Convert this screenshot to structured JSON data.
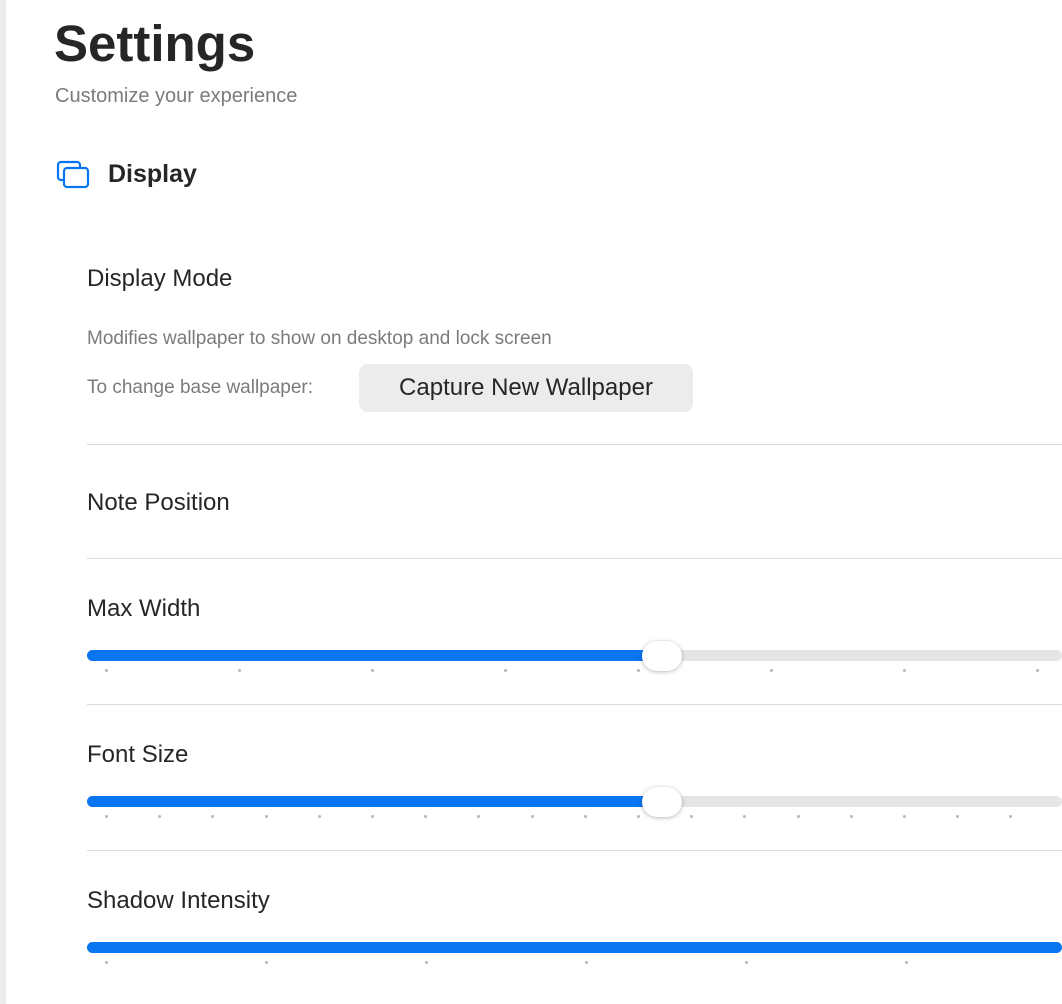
{
  "header": {
    "title": "Settings",
    "subtitle": "Customize your experience"
  },
  "section": {
    "title": "Display",
    "icon": "display-windows-icon",
    "accent": "#0a75f0"
  },
  "display_mode": {
    "label": "Display Mode",
    "description": "Modifies wallpaper to show on desktop and lock screen",
    "change_label": "To change base wallpaper:",
    "button_label": "Capture New Wallpaper"
  },
  "note_position": {
    "label": "Note Position"
  },
  "max_width": {
    "label": "Max Width",
    "value_fraction": 0.54,
    "tick_count": 8
  },
  "font_size": {
    "label": "Font Size",
    "value_fraction": 0.54,
    "tick_count": 19
  },
  "shadow_intensity": {
    "label": "Shadow Intensity",
    "value_fraction": 1.0,
    "tick_count": 7
  }
}
